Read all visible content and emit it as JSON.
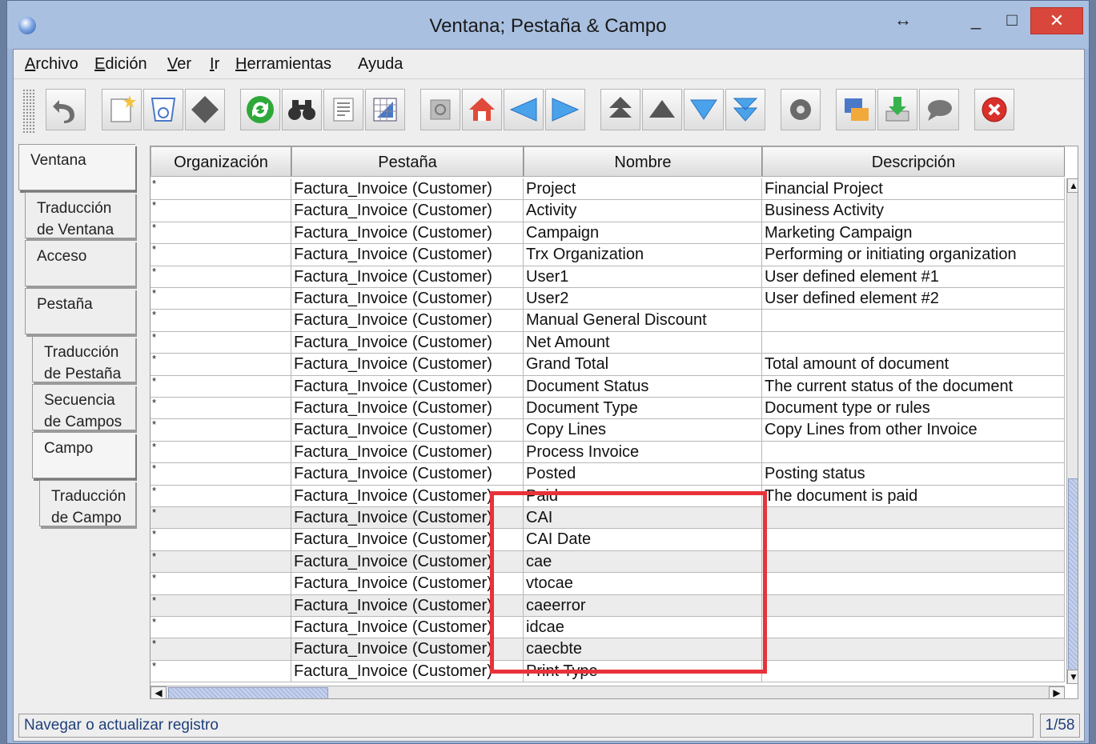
{
  "window": {
    "title": "Ventana; Pestaña & Campo",
    "controls": {
      "resize": "↔",
      "minimize": "_",
      "maximize": "□",
      "close": "✕"
    }
  },
  "menu": [
    {
      "underline": "A",
      "rest": "rchivo"
    },
    {
      "underline": "E",
      "rest": "dición"
    },
    {
      "underline": "V",
      "rest": "er"
    },
    {
      "underline": "I",
      "rest": "r"
    },
    {
      "underline": "H",
      "rest": "erramientas"
    },
    {
      "underline": "",
      "rest": "Ayuda"
    }
  ],
  "toolbar_icons": [
    "undo-icon",
    "new-record-icon",
    "copy-record-icon",
    "delete-icon",
    "refresh-icon",
    "find-icon",
    "attachment-icon",
    "report-icon",
    "history-icon",
    "home-icon",
    "previous-icon",
    "next-icon",
    "first-record-icon",
    "previous-record-icon",
    "next-record-icon",
    "last-record-icon",
    "settings-icon",
    "print-icon",
    "export-icon",
    "chat-icon",
    "close-window-icon"
  ],
  "tabs": {
    "ventana": "Ventana",
    "traduccion_ventana_1": "Traducción",
    "traduccion_ventana_2": "de Ventana",
    "acceso": "Acceso",
    "pestana": "Pestaña",
    "traduccion_pestana_1": "Traducción",
    "traduccion_pestana_2": "de Pestaña",
    "secuencia_1": "Secuencia",
    "secuencia_2": "de Campos",
    "campo": "Campo",
    "traduccion_campo_1": "Traducción",
    "traduccion_campo_2": "de Campo"
  },
  "table": {
    "headers": [
      "Organización",
      "Pestaña",
      "Nombre",
      "Descripción"
    ],
    "rows": [
      [
        "*",
        "Factura_Invoice (Customer)",
        "Project",
        "Financial Project"
      ],
      [
        "*",
        "Factura_Invoice (Customer)",
        "Activity",
        "Business Activity"
      ],
      [
        "*",
        "Factura_Invoice (Customer)",
        "Campaign",
        "Marketing Campaign"
      ],
      [
        "*",
        "Factura_Invoice (Customer)",
        "Trx Organization",
        "Performing or initiating organization"
      ],
      [
        "*",
        "Factura_Invoice (Customer)",
        "User1",
        "User defined element #1"
      ],
      [
        "*",
        "Factura_Invoice (Customer)",
        "User2",
        "User defined element #2"
      ],
      [
        "*",
        "Factura_Invoice (Customer)",
        "Manual General Discount",
        ""
      ],
      [
        "*",
        "Factura_Invoice (Customer)",
        "Net Amount",
        ""
      ],
      [
        "*",
        "Factura_Invoice (Customer)",
        "Grand Total",
        "Total amount of document"
      ],
      [
        "*",
        "Factura_Invoice (Customer)",
        "Document Status",
        "The current status of the document"
      ],
      [
        "*",
        "Factura_Invoice (Customer)",
        "Document Type",
        "Document type or rules"
      ],
      [
        "*",
        "Factura_Invoice (Customer)",
        "Copy Lines",
        "Copy Lines from other Invoice"
      ],
      [
        "*",
        "Factura_Invoice (Customer)",
        "Process Invoice",
        ""
      ],
      [
        "*",
        "Factura_Invoice (Customer)",
        "Posted",
        "Posting status"
      ],
      [
        "*",
        "Factura_Invoice (Customer)",
        "Paid",
        "The document is paid"
      ],
      [
        "*",
        "Factura_Invoice (Customer)",
        "CAI",
        ""
      ],
      [
        "*",
        "Factura_Invoice (Customer)",
        "CAI Date",
        ""
      ],
      [
        "*",
        "Factura_Invoice (Customer)",
        "cae",
        ""
      ],
      [
        "*",
        "Factura_Invoice (Customer)",
        "vtocae",
        ""
      ],
      [
        "*",
        "Factura_Invoice (Customer)",
        "caeerror",
        ""
      ],
      [
        "*",
        "Factura_Invoice (Customer)",
        "idcae",
        ""
      ],
      [
        "*",
        "Factura_Invoice (Customer)",
        "caecbte",
        ""
      ],
      [
        "*",
        "Factura_Invoice (Customer)",
        "Print Type",
        ""
      ]
    ]
  },
  "scroll": {
    "up": "▲",
    "down": "▼",
    "left": "◀",
    "right": "▶"
  },
  "status": {
    "message": "Navegar o actualizar registro",
    "count": "1/58"
  },
  "colors": {
    "highlight_box": "#e8323a",
    "title_bar": "#a9c0e0",
    "close_button": "#d9463b"
  }
}
